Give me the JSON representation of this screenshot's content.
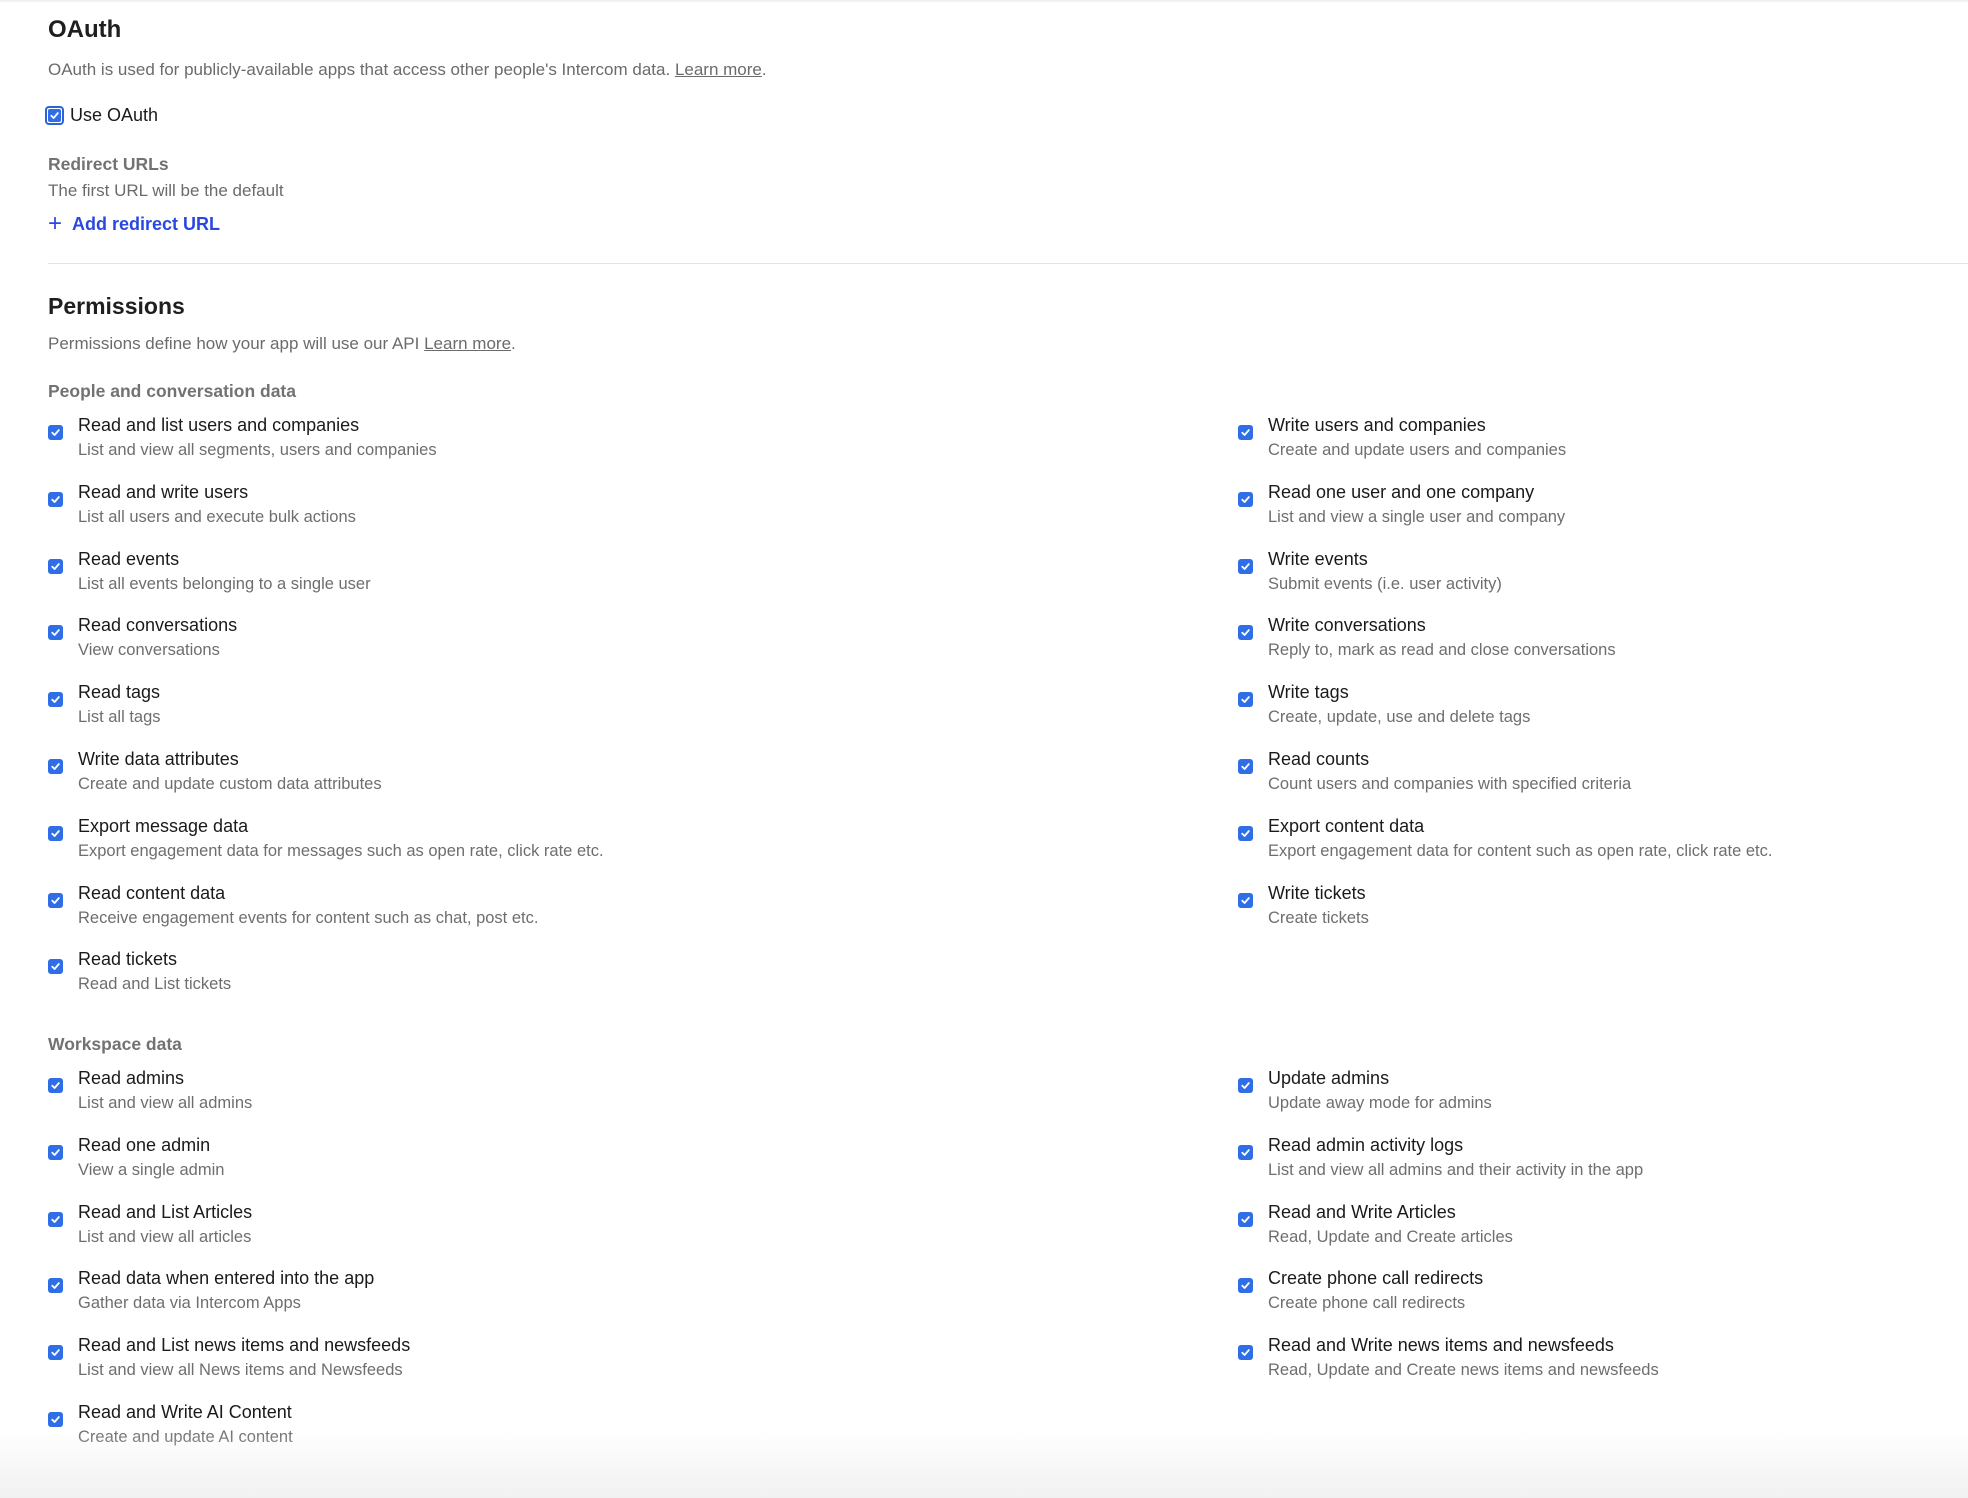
{
  "oauth": {
    "title": "OAuth",
    "description": "OAuth is used for publicly-available apps that access other people's Intercom data.",
    "learn_more": "Learn more",
    "trailing": ".",
    "use_oauth_label": "Use OAuth",
    "use_oauth_checked": true,
    "redirect_urls_title": "Redirect URLs",
    "redirect_urls_hint": "The first URL will be the default",
    "add_redirect_label": "Add redirect URL"
  },
  "permissions": {
    "title": "Permissions",
    "description": "Permissions define how your app will use our API",
    "learn_more": "Learn more",
    "trailing": ".",
    "groups": [
      {
        "title": "People and conversation data",
        "left": [
          {
            "label": "Read and list users and companies",
            "desc": "List and view all segments, users and companies",
            "checked": true
          },
          {
            "label": "Read and write users",
            "desc": "List all users and execute bulk actions",
            "checked": true
          },
          {
            "label": "Read events",
            "desc": "List all events belonging to a single user",
            "checked": true
          },
          {
            "label": "Read conversations",
            "desc": "View conversations",
            "checked": true
          },
          {
            "label": "Read tags",
            "desc": "List all tags",
            "checked": true
          },
          {
            "label": "Write data attributes",
            "desc": "Create and update custom data attributes",
            "checked": true
          },
          {
            "label": "Export message data",
            "desc": "Export engagement data for messages such as open rate, click rate etc.",
            "checked": true
          },
          {
            "label": "Read content data",
            "desc": "Receive engagement events for content such as chat, post etc.",
            "checked": true
          },
          {
            "label": "Read tickets",
            "desc": "Read and List tickets",
            "checked": true
          }
        ],
        "right": [
          {
            "label": "Write users and companies",
            "desc": "Create and update users and companies",
            "checked": true
          },
          {
            "label": "Read one user and one company",
            "desc": "List and view a single user and company",
            "checked": true
          },
          {
            "label": "Write events",
            "desc": "Submit events (i.e. user activity)",
            "checked": true
          },
          {
            "label": "Write conversations",
            "desc": "Reply to, mark as read and close conversations",
            "checked": true
          },
          {
            "label": "Write tags",
            "desc": "Create, update, use and delete tags",
            "checked": true
          },
          {
            "label": "Read counts",
            "desc": "Count users and companies with specified criteria",
            "checked": true
          },
          {
            "label": "Export content data",
            "desc": "Export engagement data for content such as open rate, click rate etc.",
            "checked": true
          },
          {
            "label": "Write tickets",
            "desc": "Create tickets",
            "checked": true
          }
        ]
      },
      {
        "title": "Workspace data",
        "left": [
          {
            "label": "Read admins",
            "desc": "List and view all admins",
            "checked": true
          },
          {
            "label": "Read one admin",
            "desc": "View a single admin",
            "checked": true
          },
          {
            "label": "Read and List Articles",
            "desc": "List and view all articles",
            "checked": true
          },
          {
            "label": "Read data when entered into the app",
            "desc": "Gather data via Intercom Apps",
            "checked": true
          },
          {
            "label": "Read and List news items and newsfeeds",
            "desc": "List and view all News items and Newsfeeds",
            "checked": true
          },
          {
            "label": "Read and Write AI Content",
            "desc": "Create and update AI content",
            "checked": true
          }
        ],
        "right": [
          {
            "label": "Update admins",
            "desc": "Update away mode for admins",
            "checked": true
          },
          {
            "label": "Read admin activity logs",
            "desc": "List and view all admins and their activity in the app",
            "checked": true
          },
          {
            "label": "Read and Write Articles",
            "desc": "Read, Update and Create articles",
            "checked": true
          },
          {
            "label": "Create phone call redirects",
            "desc": "Create phone call redirects",
            "checked": true
          },
          {
            "label": "Read and Write news items and newsfeeds",
            "desc": "Read, Update and Create news items and newsfeeds",
            "checked": true
          }
        ]
      }
    ]
  },
  "colors": {
    "checkbox": "#2f6ee6",
    "link_blue": "#2a48e0",
    "muted_text": "#6b6b6b"
  }
}
